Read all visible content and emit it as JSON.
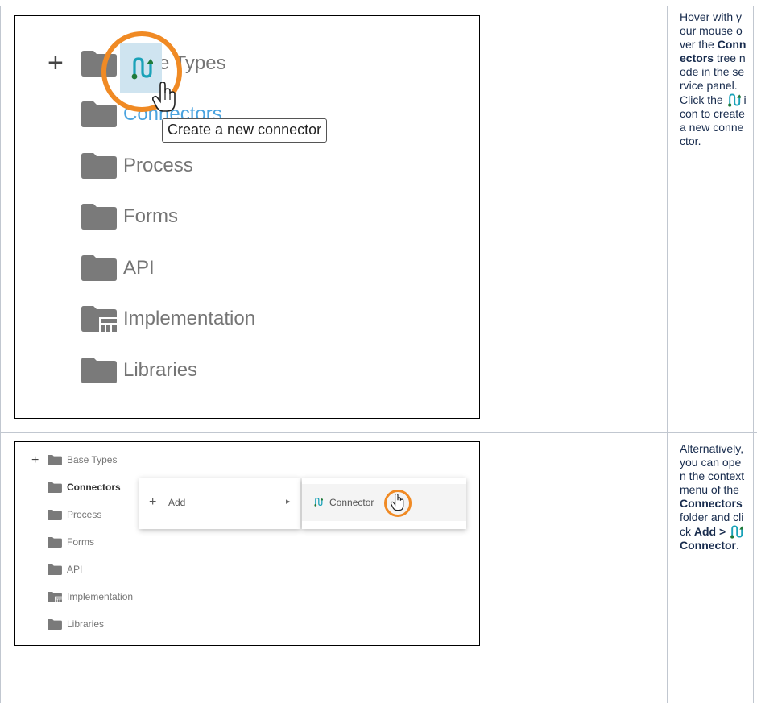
{
  "colors": {
    "folder": "#7a7a7a",
    "connector_teal": "#1aa2b8",
    "connector_green": "#1f7a3a",
    "highlight_ring": "#f08a24",
    "hover_bg": "#cfe4f0",
    "link_blue": "#4aa3df"
  },
  "row1": {
    "screenshot": {
      "tree": {
        "expand_symbol": "+",
        "items": [
          {
            "label": "Base Types",
            "label_visible": "e Types",
            "icon": "folder-icon"
          },
          {
            "label": "Connectors",
            "icon": "folder-icon"
          },
          {
            "label": "Process",
            "icon": "folder-icon"
          },
          {
            "label": "Forms",
            "icon": "folder-icon"
          },
          {
            "label": "API",
            "icon": "folder-icon"
          },
          {
            "label": "Implementation",
            "icon": "implementation-folder-icon"
          },
          {
            "label": "Libraries",
            "icon": "folder-icon"
          }
        ]
      },
      "hover_button_icon": "connector-icon",
      "cursor_icon": "hand-pointer-icon",
      "tooltip": "Create a new connector"
    },
    "description": {
      "t1": "Hover with your mouse over the ",
      "b1": "Connectors",
      "t2": " tree node in the service panel. Click the ",
      "t3": " icon to create a new connector."
    }
  },
  "row2": {
    "screenshot": {
      "tree": {
        "expand_symbol": "+",
        "items": [
          {
            "label": "Base Types",
            "icon": "folder-icon"
          },
          {
            "label": "Connectors",
            "icon": "folder-icon"
          },
          {
            "label": "Process",
            "icon": "folder-icon"
          },
          {
            "label": "Forms",
            "icon": "folder-icon"
          },
          {
            "label": "API",
            "icon": "folder-icon"
          },
          {
            "label": "Implementation",
            "icon": "implementation-folder-icon"
          },
          {
            "label": "Libraries",
            "icon": "folder-icon"
          }
        ]
      },
      "context_menu": {
        "item_symbol": "+",
        "item_label": "Add",
        "submenu_arrow": "▸"
      },
      "submenu": {
        "item_label": "Connector",
        "icon": "connector-icon"
      }
    },
    "description": {
      "t1": "Alternatively, you can open the context menu of the ",
      "b1": "Connectors",
      "t2": " folder and click ",
      "b2": "Add > ",
      "b3": "Connector",
      "t3": "."
    }
  }
}
